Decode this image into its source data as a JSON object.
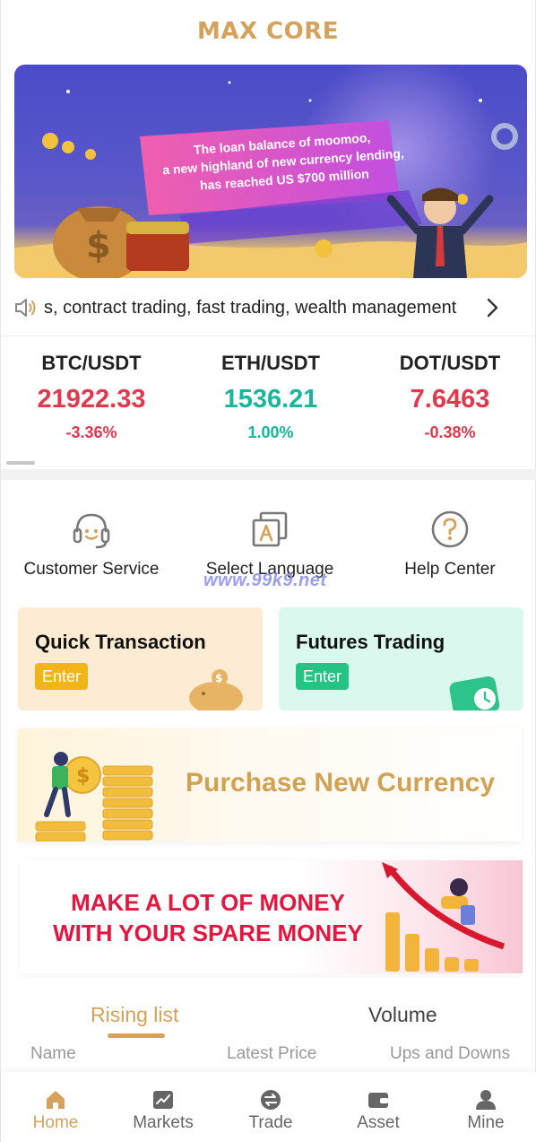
{
  "app": {
    "title": "MAX CORE",
    "accent": "#d4a25a"
  },
  "banner": {
    "headline": [
      "The loan balance of moomoo,",
      "a new highland of new currency lending,",
      "has reached US $700 million"
    ]
  },
  "notice": {
    "icon": "speaker-icon",
    "text": "s, contract trading, fast trading, wealth management"
  },
  "tickers": [
    {
      "pair": "BTC/USDT",
      "price": "21922.33",
      "change": "-3.36%",
      "trend": "down"
    },
    {
      "pair": "ETH/USDT",
      "price": "1536.21",
      "change": "1.00%",
      "trend": "up"
    },
    {
      "pair": "DOT/USDT",
      "price": "7.6463",
      "change": "-0.38%",
      "trend": "down"
    }
  ],
  "actions": [
    {
      "label": "Customer Service",
      "icon": "headset-icon"
    },
    {
      "label": "Select Language",
      "icon": "language-icon"
    },
    {
      "label": "Help Center",
      "icon": "help-icon"
    }
  ],
  "watermark": "www.99k9.net",
  "cards": {
    "quick": {
      "title": "Quick Transaction",
      "enter": "Enter"
    },
    "futures": {
      "title": "Futures Trading",
      "enter": "Enter"
    }
  },
  "purchase": {
    "text": "Purchase New Currency"
  },
  "money": {
    "line1": "MAKE A LOT OF MONEY",
    "line2": "WITH YOUR SPARE MONEY"
  },
  "rank": {
    "tabs": [
      "Rising list",
      "Volume"
    ],
    "columns": [
      "Name",
      "Latest Price",
      "Ups and Downs"
    ]
  },
  "nav": [
    {
      "label": "Home",
      "icon": "home-icon",
      "active": true
    },
    {
      "label": "Markets",
      "icon": "markets-icon",
      "active": false
    },
    {
      "label": "Trade",
      "icon": "trade-icon",
      "active": false
    },
    {
      "label": "Asset",
      "icon": "wallet-icon",
      "active": false
    },
    {
      "label": "Mine",
      "icon": "user-icon",
      "active": false
    }
  ],
  "colors": {
    "down": "#e1384d",
    "up": "#16b79a"
  }
}
